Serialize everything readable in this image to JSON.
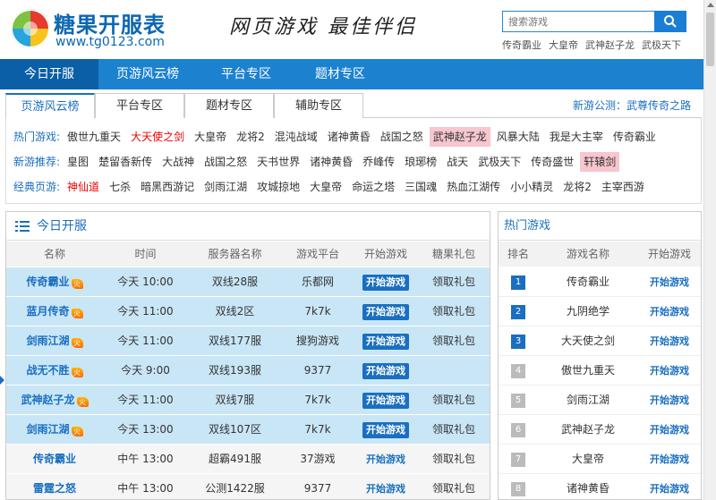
{
  "header": {
    "logo_title": "糖果开服表",
    "logo_url": "www.tg0123.com",
    "slogan": "网页游戏 最佳伴侣",
    "search_placeholder": "搜索游戏",
    "search_links": [
      "传奇霸业",
      "大皇帝",
      "武神赵子龙",
      "武极天下"
    ]
  },
  "topnav": [
    "今日开服",
    "页游风云榜",
    "平台专区",
    "题材专区"
  ],
  "tabs": [
    "页游风云榜",
    "平台专区",
    "题材专区",
    "辅助专区"
  ],
  "notice": "新游公测：武尊传奇之路",
  "taglines": [
    {
      "label": "热门游戏:",
      "games": [
        "傲世九重天",
        "大天使之剑",
        "大皇帝",
        "龙将2",
        "混沌战域",
        "诸神黄昏",
        "战国之怒",
        "武神赵子龙",
        "风暴大陆",
        "我是大主宰",
        "传奇霸业"
      ]
    },
    {
      "label": "新游推荐:",
      "games": [
        "皇图",
        "楚留香新传",
        "大战神",
        "战国之怒",
        "天书世界",
        "诸神黄昏",
        "乔峰传",
        "琅琊榜",
        "战天",
        "武极天下",
        "传奇盛世",
        "轩辕剑"
      ]
    },
    {
      "label": "经典页游:",
      "games": [
        "神仙道",
        "七杀",
        "暗黑西游记",
        "剑雨江湖",
        "攻城掠地",
        "大皇帝",
        "命运之塔",
        "三国魂",
        "热血江湖传",
        "小小精灵",
        "龙将2",
        "主宰西游"
      ]
    }
  ],
  "today": {
    "title": "今日开服",
    "columns": [
      "名称",
      "时间",
      "服务器名称",
      "游戏平台",
      "开始游戏",
      "糖果礼包"
    ],
    "rows": [
      {
        "name": "传奇霸业",
        "time": "今天 10:00",
        "server": "双线28服",
        "platform": "乐都网",
        "start": "开始游戏",
        "gift": "领取礼包"
      },
      {
        "name": "蓝月传奇",
        "time": "今天 11:00",
        "server": "双线2区",
        "platform": "7k7k",
        "start": "开始游戏",
        "gift": "领取礼包"
      },
      {
        "name": "剑雨江湖",
        "time": "今天 11:00",
        "server": "双线177服",
        "platform": "搜狗游戏",
        "start": "开始游戏",
        "gift": "领取礼包"
      },
      {
        "name": "战无不胜",
        "time": "今天 9:00",
        "server": "双线193服",
        "platform": "9377",
        "start": "开始游戏",
        "gift": ""
      },
      {
        "name": "武神赵子龙",
        "time": "今天 11:00",
        "server": "双线7服",
        "platform": "7k7k",
        "start": "开始游戏",
        "gift": "领取礼包"
      },
      {
        "name": "剑雨江湖",
        "time": "今天 13:00",
        "server": "双线107区",
        "platform": "7k7k",
        "start": "开始游戏",
        "gift": "领取礼包"
      },
      {
        "name": "传奇霸业",
        "time": "中午 13:00",
        "server": "超霸491服",
        "platform": "37游戏",
        "start": "开始游戏",
        "gift": "领取礼包"
      },
      {
        "name": "雷霆之怒",
        "time": "中午 13:00",
        "server": "公测1422服",
        "platform": "9377",
        "start": "开始游戏",
        "gift": "领取礼包"
      }
    ]
  },
  "hot": {
    "title": "热门游戏",
    "columns": [
      "排名",
      "游戏名称",
      "开始游戏"
    ],
    "rows": [
      {
        "rank": "1",
        "name": "传奇霸业",
        "start": "开始游戏"
      },
      {
        "rank": "2",
        "name": "九阴绝学",
        "start": "开始游戏"
      },
      {
        "rank": "3",
        "name": "大天使之剑",
        "start": "开始游戏"
      },
      {
        "rank": "4",
        "name": "傲世九重天",
        "start": "开始游戏"
      },
      {
        "rank": "5",
        "name": "剑雨江湖",
        "start": "开始游戏"
      },
      {
        "rank": "6",
        "name": "武神赵子龙",
        "start": "开始游戏"
      },
      {
        "rank": "7",
        "name": "大皇帝",
        "start": "开始游戏"
      },
      {
        "rank": "8",
        "name": "诸神黄昏",
        "start": "开始游戏"
      }
    ]
  },
  "colors": {
    "brand": "#1c82d0",
    "highlight": "#f7c6cf",
    "hot_text": "#ee0000"
  }
}
